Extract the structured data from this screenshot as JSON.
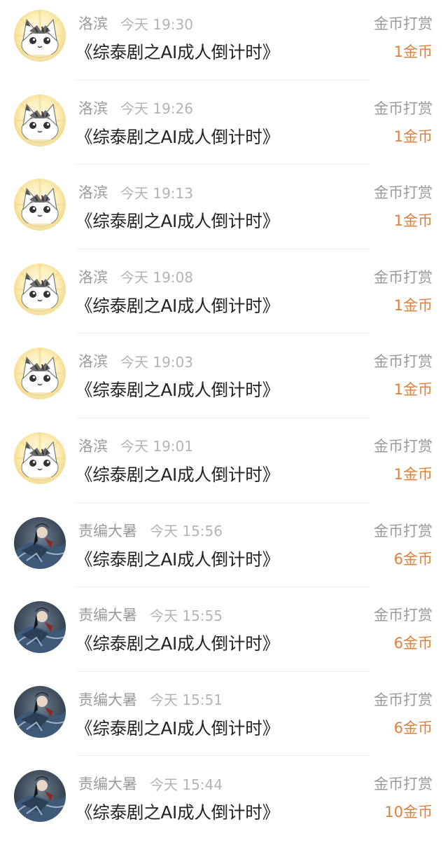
{
  "rows": [
    {
      "name": "洛滨",
      "time": "今天 19:30",
      "title": "《综泰剧之AI成人倒计时》",
      "type": "金币打赏",
      "amount": "1金币",
      "avatar": "cat-avatar-icon"
    },
    {
      "name": "洛滨",
      "time": "今天 19:26",
      "title": "《综泰剧之AI成人倒计时》",
      "type": "金币打赏",
      "amount": "1金币",
      "avatar": "cat-avatar-icon"
    },
    {
      "name": "洛滨",
      "time": "今天 19:13",
      "title": "《综泰剧之AI成人倒计时》",
      "type": "金币打赏",
      "amount": "1金币",
      "avatar": "cat-avatar-icon"
    },
    {
      "name": "洛滨",
      "time": "今天 19:08",
      "title": "《综泰剧之AI成人倒计时》",
      "type": "金币打赏",
      "amount": "1金币",
      "avatar": "cat-avatar-icon"
    },
    {
      "name": "洛滨",
      "time": "今天 19:03",
      "title": "《综泰剧之AI成人倒计时》",
      "type": "金币打赏",
      "amount": "1金币",
      "avatar": "cat-avatar-icon"
    },
    {
      "name": "洛滨",
      "time": "今天 19:01",
      "title": "《综泰剧之AI成人倒计时》",
      "type": "金币打赏",
      "amount": "1金币",
      "avatar": "cat-avatar-icon"
    },
    {
      "name": "责编大暑",
      "time": "今天 15:56",
      "title": "《综泰剧之AI成人倒计时》",
      "type": "金币打赏",
      "amount": "6金币",
      "avatar": "warrior-avatar-icon"
    },
    {
      "name": "责编大暑",
      "time": "今天 15:55",
      "title": "《综泰剧之AI成人倒计时》",
      "type": "金币打赏",
      "amount": "6金币",
      "avatar": "warrior-avatar-icon"
    },
    {
      "name": "责编大暑",
      "time": "今天 15:51",
      "title": "《综泰剧之AI成人倒计时》",
      "type": "金币打赏",
      "amount": "6金币",
      "avatar": "warrior-avatar-icon"
    },
    {
      "name": "责编大暑",
      "time": "今天 15:44",
      "title": "《综泰剧之AI成人倒计时》",
      "type": "金币打赏",
      "amount": "10金币",
      "avatar": "warrior-avatar-icon"
    }
  ],
  "colors": {
    "name": "#9a9a9a",
    "time": "#b4b4b4",
    "title": "#222222",
    "amount": "#e0803a",
    "divider": "#f0f0f0"
  }
}
